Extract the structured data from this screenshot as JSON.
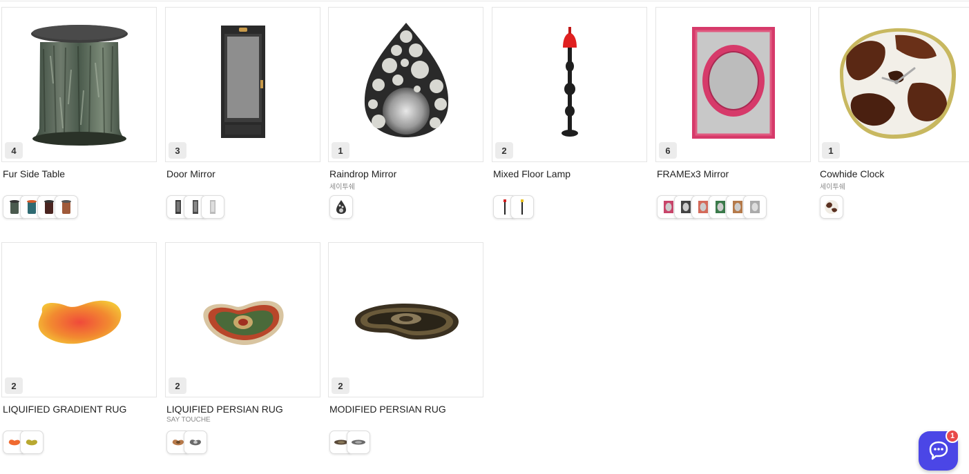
{
  "products": [
    {
      "title": "Fur Side Table",
      "subtitle": "",
      "count": "4",
      "icon": "fur-side-table-image",
      "swatches": [
        "#4a5a4e",
        "#2e6a72",
        "#4a2420",
        "#a05a3a"
      ]
    },
    {
      "title": "Door Mirror",
      "subtitle": "",
      "count": "3",
      "icon": "door-mirror-image",
      "swatches": [
        "#3a3a3a",
        "#4a4a4a",
        "#9a9a9a"
      ]
    },
    {
      "title": "Raindrop Mirror",
      "subtitle": "세이투쉐",
      "count": "1",
      "icon": "raindrop-mirror-image",
      "swatches": [
        "#333333"
      ]
    },
    {
      "title": "Mixed Floor Lamp",
      "subtitle": "",
      "count": "2",
      "icon": "floor-lamp-image",
      "swatches": [
        "#c0392b",
        "#d4a017"
      ]
    },
    {
      "title": "FRAMEx3 Mirror",
      "subtitle": "",
      "count": "6",
      "icon": "frame-mirror-image",
      "swatches": [
        "#c8456a",
        "#444444",
        "#d46a5a",
        "#3a7a4a",
        "#b57a4a",
        "#aaaaaa"
      ]
    },
    {
      "title": "Cowhide Clock",
      "subtitle": "세이투쉐",
      "count": "1",
      "icon": "cowhide-clock-image",
      "swatches": [
        "#5a3020"
      ]
    },
    {
      "title": "LIQUIFIED GRADIENT RUG",
      "subtitle": "",
      "count": "2",
      "icon": "gradient-rug-image",
      "swatches": [
        "#f06a30",
        "#b8a830"
      ]
    },
    {
      "title": "LIQUIFIED PERSIAN RUG",
      "subtitle": "SAY TOUCHE",
      "count": "2",
      "icon": "persian-rug-image",
      "swatches": [
        "#b87a4a",
        "#6a6a6a"
      ]
    },
    {
      "title": "MODIFIED PERSIAN RUG",
      "subtitle": "",
      "count": "2",
      "icon": "modified-persian-rug-image",
      "swatches": [
        "#5a4a3a",
        "#6a6a6a"
      ]
    }
  ],
  "chat": {
    "badge": "1",
    "icon": "chat-icon"
  }
}
